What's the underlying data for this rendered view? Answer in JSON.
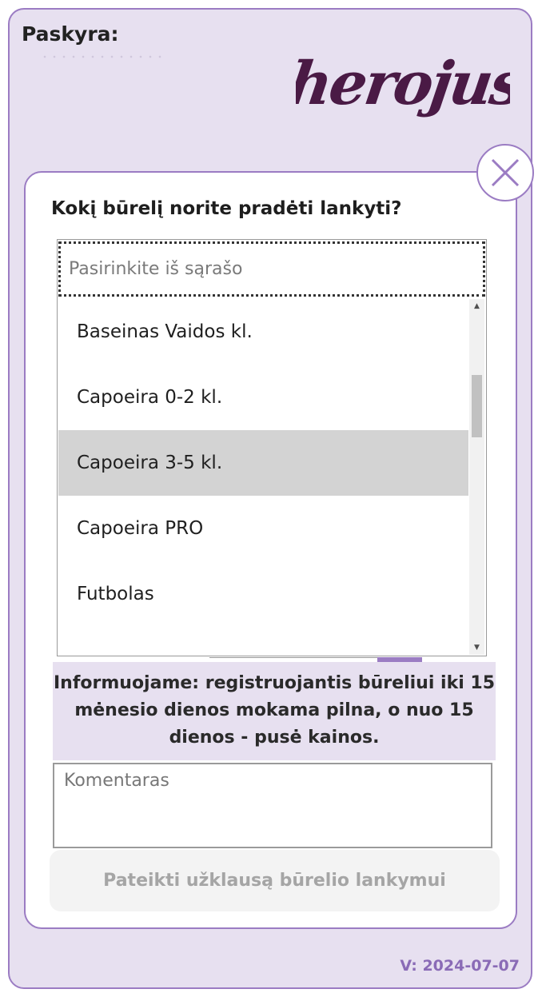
{
  "account": {
    "label": "Paskyra:"
  },
  "brand": {
    "logo_text": "herojus+"
  },
  "modal": {
    "question": "Kokį būrelį norite pradėti lankyti?",
    "search_placeholder": "Pasirinkite iš sąrašo",
    "options": [
      {
        "label": "Baseinas Vaidos kl.",
        "selected": false
      },
      {
        "label": "Capoeira 0-2 kl.",
        "selected": false
      },
      {
        "label": "Capoeira 3-5 kl.",
        "selected": true
      },
      {
        "label": "Capoeira PRO",
        "selected": false
      },
      {
        "label": "Futbolas",
        "selected": false
      }
    ],
    "info_text": "Informuojame: registruojantis būreliui iki 15 mėnesio dienos mokama pilna, o nuo 15 dienos - pusė kainos.",
    "comment_placeholder": "Komentaras",
    "submit_label": "Pateikti užklausą būrelio lankymui"
  },
  "footer": {
    "version": "V: 2024-07-07"
  },
  "colors": {
    "accent": "#9b7cc3",
    "panel_background": "#e7e0f0",
    "logo": "#4a1a45",
    "selected_option": "#d3d3d3",
    "version_text": "#8a6bb6"
  },
  "icons": {
    "close": "close-icon",
    "scroll_up": "scroll-up-arrow-icon",
    "scroll_down": "scroll-down-arrow-icon"
  }
}
